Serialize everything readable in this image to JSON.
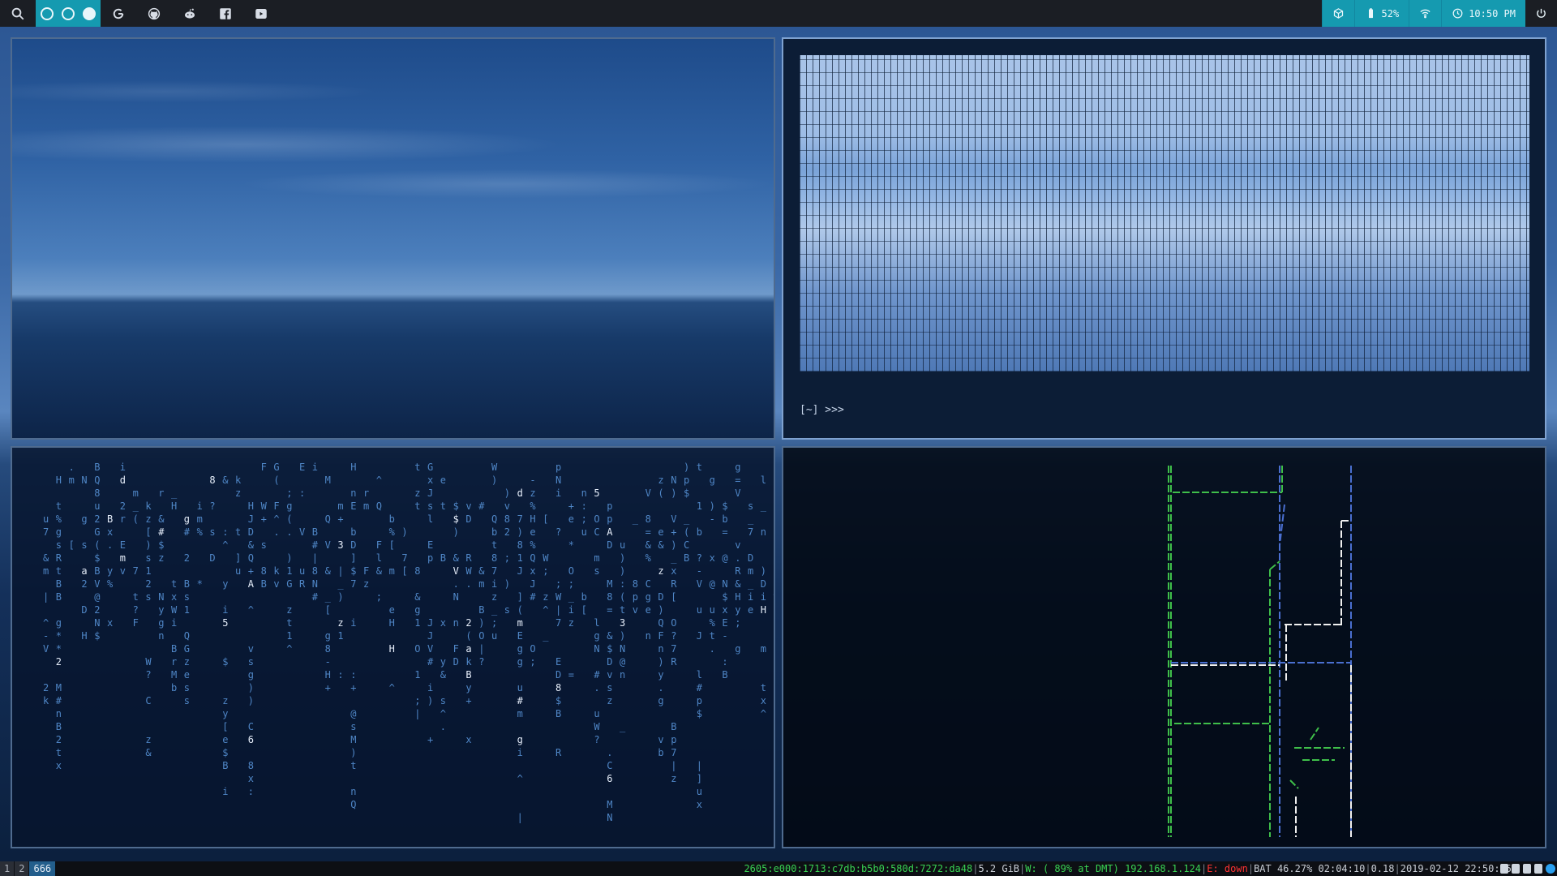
{
  "topbar": {
    "left_icons": [
      "search-icon",
      "google-icon",
      "github-icon",
      "reddit-icon",
      "facebook-icon",
      "youtube-icon"
    ],
    "workspaces": [
      {
        "name": "workspace-1",
        "active": false
      },
      {
        "name": "workspace-2",
        "active": false
      },
      {
        "name": "workspace-3",
        "active": true
      }
    ],
    "battery": "52%",
    "clock": "10:50 PM",
    "accent": "#159ab0",
    "bg": "#1b1e24"
  },
  "terminal": {
    "prompt": "[~]  >>>"
  },
  "matrix": {
    "color": "#4f86c6",
    "bright_color": "#e6eefa",
    "bright_chars": [
      "2",
      "a",
      "B",
      "d",
      "m",
      "#",
      "g",
      "8",
      "5",
      "A",
      "6",
      "3",
      "z",
      "H",
      "$",
      "V"
    ]
  },
  "pipes": {
    "colors": [
      "#3fbf4a",
      "#4a6fd0",
      "#f0f0f0"
    ]
  },
  "bottombar": {
    "workspaces": [
      "1",
      "2",
      "666"
    ],
    "active_workspace": "666",
    "ipv6": "2605:e000:1713:c7db:b5b0:580d:7272:da48",
    "memory": "5.2 GiB",
    "wifi": "W: ( 89% at DMT) 192.168.1.124",
    "ethernet": "E: down",
    "battery": "BAT 46.27% 02:04:10",
    "load": "0.18",
    "datetime": "2019-02-12 22:50:45"
  }
}
